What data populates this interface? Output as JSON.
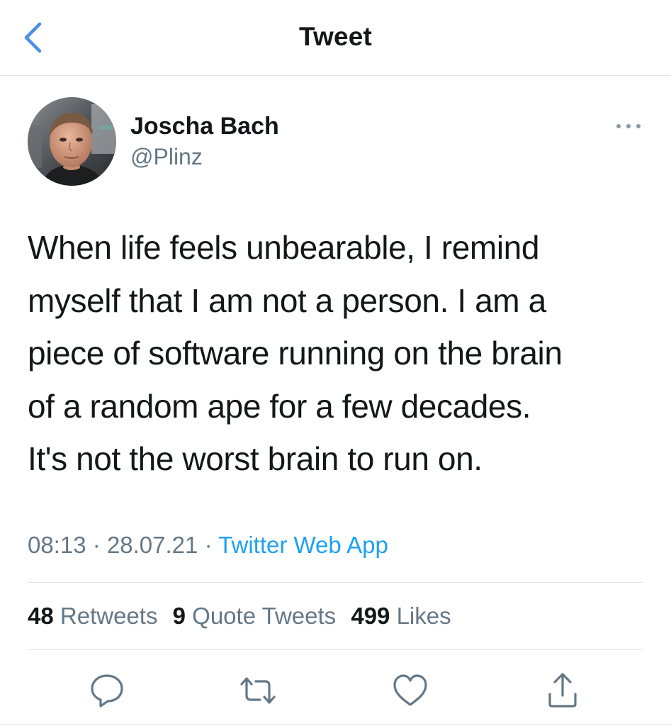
{
  "header": {
    "title": "Tweet",
    "back_icon": "chevron-left-icon"
  },
  "tweet": {
    "author": {
      "name": "Joscha Bach",
      "handle": "@Plinz",
      "avatar": "profile-photo"
    },
    "more_icon": "more-horizontal-icon",
    "lines": [
      "When life feels unbearable, I remind",
      "myself that I am not a person. I am a",
      "piece of software running on the brain",
      "of a random ape for a few decades.",
      "It's not the worst brain to run on."
    ],
    "time": "08:13",
    "separator": "·",
    "date": "28.07.21",
    "source": "Twitter Web App",
    "stats": {
      "retweets_count": "48",
      "retweets_label": "Retweets",
      "quotes_count": "9",
      "quotes_label": "Quote Tweets",
      "likes_count": "499",
      "likes_label": "Likes"
    },
    "actions": [
      "reply-icon",
      "retweet-icon",
      "like-icon",
      "share-icon"
    ]
  },
  "colors": {
    "accent": "#1da1f2",
    "back_arrow": "#4a90e2",
    "secondary_text": "#657786",
    "primary_text": "#14171a",
    "divider": "#e1e4e7",
    "action_icon": "#657786"
  }
}
